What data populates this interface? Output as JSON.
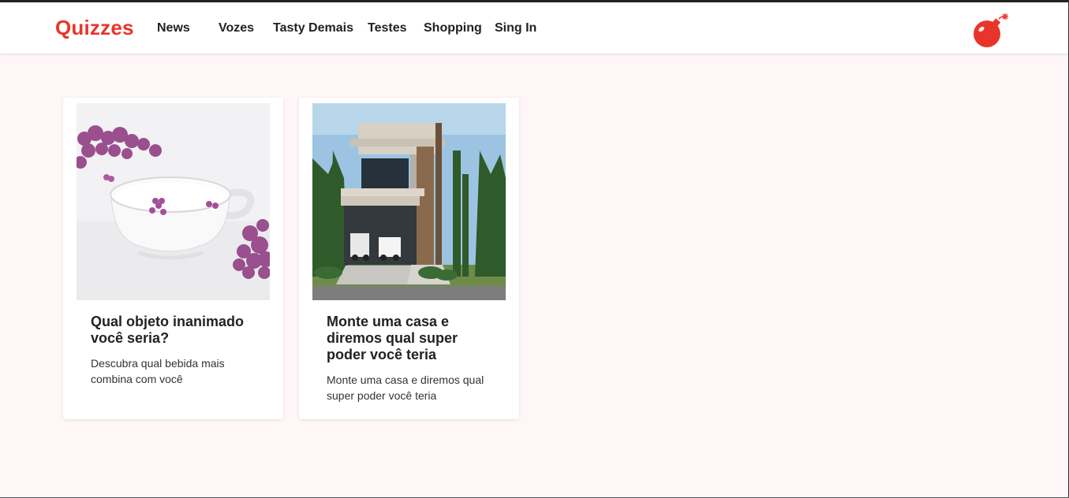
{
  "header": {
    "logo": "Quizzes",
    "nav": [
      "News",
      "Vozes",
      "Tasty Demais",
      "Testes",
      "Shopping",
      "Sing In"
    ],
    "brand_color": "#e8352b",
    "bomb_icon": "bomb-icon"
  },
  "cards": [
    {
      "title": "Qual objeto inanimado você seria?",
      "description": "Descubra qual bebida mais combina com você"
    },
    {
      "title": "Monte uma casa e diremos qual super poder você teria",
      "description": "Monte uma casa e diremos qual super poder você teria"
    }
  ]
}
